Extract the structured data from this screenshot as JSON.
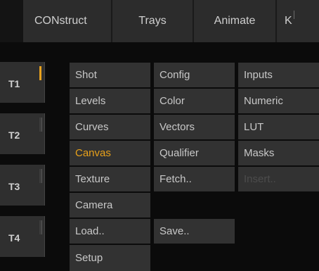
{
  "top_tabs": [
    "CONstruct",
    "Trays",
    "Animate",
    "K"
  ],
  "trays": [
    {
      "label": "T1",
      "active": true
    },
    {
      "label": "T2",
      "active": false
    },
    {
      "label": "T3",
      "active": false
    },
    {
      "label": "T4",
      "active": false
    }
  ],
  "menu": {
    "col1": [
      "Shot",
      "Levels",
      "Curves",
      "Canvas",
      "Texture",
      "Camera",
      "Load..",
      "Setup"
    ],
    "col2": [
      "Config",
      "Color",
      "Vectors",
      "Qualifier",
      "Fetch..",
      "Save.."
    ],
    "col3": [
      "Inputs",
      "Numeric",
      "LUT",
      "Masks",
      "Insert.."
    ]
  },
  "colors": {
    "accent": "#e8a11a",
    "panel": "#323232",
    "background": "#0b0b0b"
  }
}
